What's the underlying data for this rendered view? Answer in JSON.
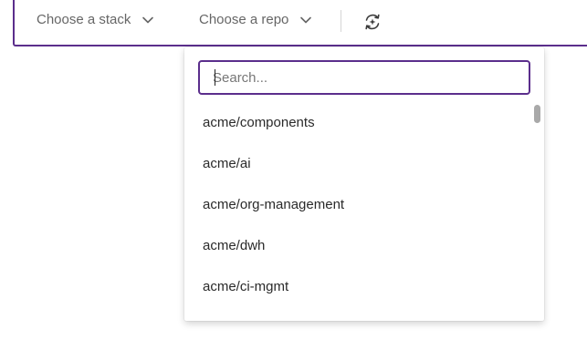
{
  "toolbar": {
    "stack_label": "Choose a stack",
    "repo_label": "Choose a repo",
    "refresh_icon": "refresh-sparkle-icon"
  },
  "dropdown": {
    "search_placeholder": "Search...",
    "items": [
      "acme/components",
      "acme/ai",
      "acme/org-management",
      "acme/dwh",
      "acme/ci-mgmt"
    ]
  },
  "colors": {
    "accent": "#5b2e8c",
    "muted_text": "#666666"
  }
}
